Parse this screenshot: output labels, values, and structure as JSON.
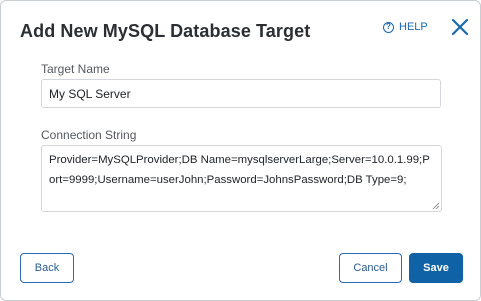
{
  "dialog": {
    "title": "Add New MySQL Database Target",
    "help_label": "HELP",
    "help_icon": "question-circle-icon",
    "close_icon": "close-icon",
    "accent_color": "#1a68b0"
  },
  "form": {
    "target_name_label": "Target Name",
    "target_name_value": "My SQL Server",
    "connection_string_label": "Connection String",
    "connection_string_value": "Provider=MySQLProvider;DB Name=mysqlserverLarge;Server=10.0.1.99;Port=9999;Username=userJohn;Password=JohnsPassword;DB Type=9;"
  },
  "footer": {
    "back_label": "Back",
    "cancel_label": "Cancel",
    "save_label": "Save"
  }
}
